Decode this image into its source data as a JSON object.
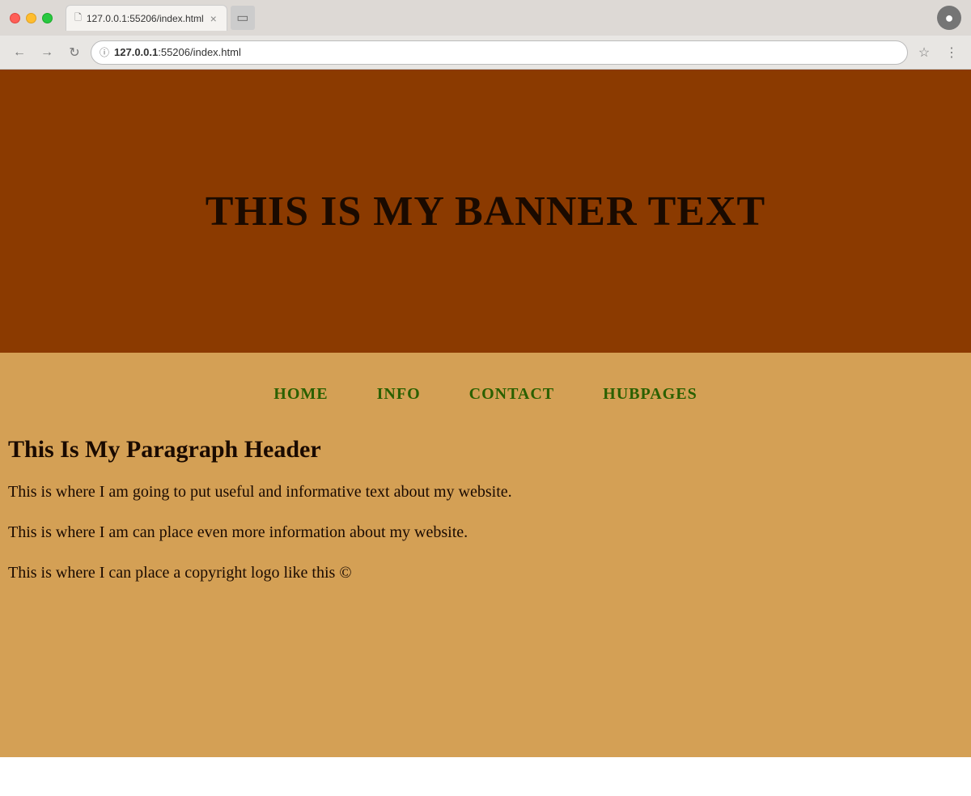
{
  "browser": {
    "url_bold": "127.0.0.1",
    "url_rest": ":55206/index.html",
    "tab_title": "127.0.0.1:55206/index.html",
    "tab_icon": "🗋",
    "back_icon": "←",
    "forward_icon": "→",
    "reload_icon": "↻",
    "star_icon": "☆",
    "menu_icon": "⋮",
    "profile_icon": "👤",
    "close_icon": "×"
  },
  "website": {
    "banner_text": "THIS IS MY BANNER TEXT",
    "nav": {
      "home": "HOME",
      "info": "INFO",
      "contact": "CONTACT",
      "hubpages": "HUBPAGES"
    },
    "paragraph_header": "This Is My Paragraph Header",
    "paragraph_1": "This is where I am going to put useful and informative text about my website.",
    "paragraph_2": "This is where I am can place even more information about my website.",
    "paragraph_3": "This is where I can place a copyright logo like this ©"
  },
  "colors": {
    "banner_bg": "#8B3A00",
    "content_bg": "#D4A055",
    "nav_link": "#2a6000",
    "text_dark": "#1a0a00"
  }
}
